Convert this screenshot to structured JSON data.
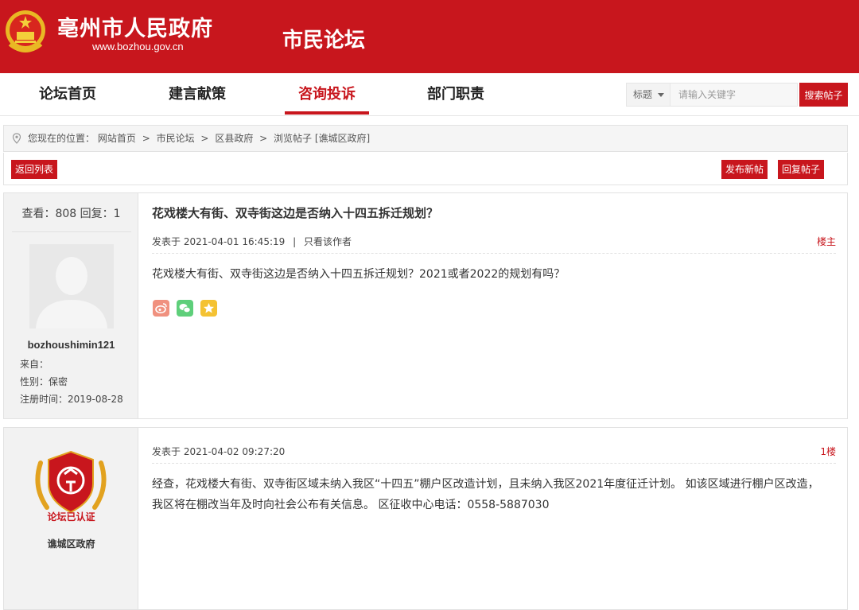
{
  "header": {
    "site_title": "亳州市人民政府",
    "site_url": "www.bozhou.gov.cn",
    "forum_title": "市民论坛"
  },
  "nav": {
    "items": [
      {
        "label": "论坛首页"
      },
      {
        "label": "建言献策"
      },
      {
        "label": "咨询投诉",
        "active": true
      },
      {
        "label": "部门职责"
      }
    ]
  },
  "search": {
    "type_selected": "标题",
    "placeholder": "请输入关键字",
    "button_label": "搜索帖子"
  },
  "breadcrumb": {
    "prefix": "您现在的位置：",
    "items": [
      "网站首页",
      "市民论坛",
      "区县政府",
      "浏览帖子 [谯城区政府]"
    ],
    "separator": ">"
  },
  "actions": {
    "back_label": "返回列表",
    "new_post_label": "发布新帖",
    "reply_label": "回复帖子"
  },
  "accent_color": "#c8161d",
  "posts": [
    {
      "stats": "查看：808 回复：1",
      "username": "bozhoushimin121",
      "from_label": "来自：",
      "gender_label": "性别：保密",
      "register_label": "注册时间：2019-08-28",
      "title": "花戏楼大有街、双寺街这边是否纳入十四五拆迁规划？",
      "meta_time": "发表于 2021-04-01 16:45:19",
      "meta_sep": "|",
      "meta_author_only": "只看该作者",
      "floor": "楼主",
      "content": "花戏楼大有街、双寺街这边是否纳入十四五拆迁规划？2021或者2022的规划有吗？",
      "share_icons": [
        "weibo-icon",
        "wechat-icon",
        "qzone-star-icon"
      ]
    },
    {
      "badge_text": "论坛已认证",
      "org_name": "谯城区政府",
      "meta_time": "发表于 2021-04-02 09:27:20",
      "floor": "1楼",
      "content_line1": "经查，花戏楼大有街、双寺街区域未纳入我区“十四五”棚户区改造计划，且未纳入我区2021年度征迁计划。 如该区域进行棚户区改造，",
      "content_line2": "我区将在棚改当年及时向社会公布有关信息。 区征收中心电话：0558-5887030"
    }
  ]
}
